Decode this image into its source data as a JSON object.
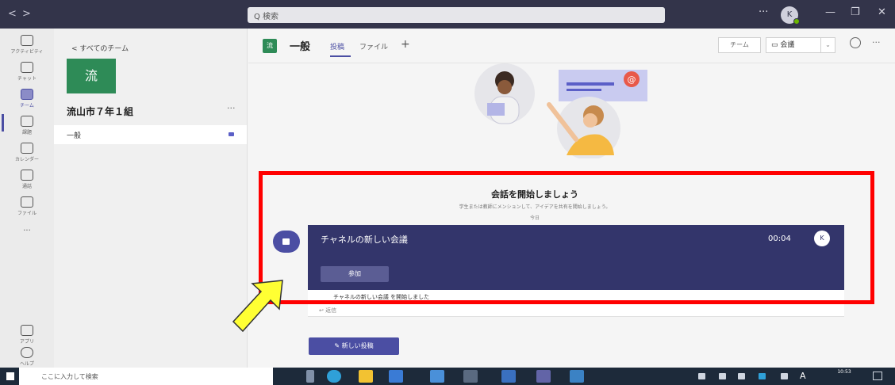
{
  "titlebar": {
    "back": "<",
    "forward": ">",
    "search_placeholder": "Q 検索",
    "more": "···",
    "avatar_initial": "K",
    "minimize": "—",
    "maximize": "❐",
    "close": "✕"
  },
  "rail": {
    "items": [
      {
        "label": "アクティビティ"
      },
      {
        "label": "チャット"
      },
      {
        "label": "チーム"
      },
      {
        "label": "課題"
      },
      {
        "label": "カレンダー"
      },
      {
        "label": "通話"
      },
      {
        "label": "ファイル"
      },
      {
        "label": "アプリ"
      },
      {
        "label": "ヘルプ"
      }
    ],
    "more": "···"
  },
  "team_panel": {
    "back_label": "< すべてのチーム",
    "team_tile": "流",
    "team_name": "流山市７年１組",
    "more": "···",
    "channel": "一般"
  },
  "channel_header": {
    "tile": "流",
    "title": "一般",
    "tabs": [
      "投稿",
      "ファイル"
    ],
    "add": "+",
    "team_button": "チーム",
    "meet_button": "会議",
    "more": "···"
  },
  "conversation": {
    "welcome_title": "会話を開始しましょう",
    "welcome_sub": "学生または教師にメンションして、アイデアを共有を開始しましょう。",
    "day_label": "今日",
    "meeting": {
      "title": "チャネルの新しい会議",
      "time": "00:04",
      "avatar_initial": "K",
      "join_label": "参加",
      "footer": "チャネルの新しい会議 を開始しました",
      "reply": "↩ 返信"
    },
    "new_post": "新しい投稿"
  },
  "taskbar": {
    "search_placeholder": "ここに入力して検索",
    "clock_time": "10:53",
    "ime": "A"
  },
  "colors": {
    "accent": "#4b4ea3",
    "highlight_box": "#ff0000",
    "arrow": "#ffff33",
    "team_green": "#2e8b57"
  }
}
